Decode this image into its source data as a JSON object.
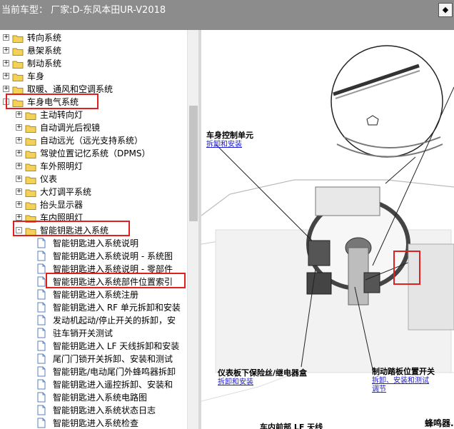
{
  "window": {
    "title": "当前车型： 厂家:D-东风本田UR-V2018",
    "corner_button": "◆"
  },
  "tree": {
    "items": [
      {
        "label": "转向系统",
        "type": "folder",
        "level": 0,
        "expander": "+"
      },
      {
        "label": "悬架系统",
        "type": "folder",
        "level": 0,
        "expander": "+"
      },
      {
        "label": "制动系统",
        "type": "folder",
        "level": 0,
        "expander": "+"
      },
      {
        "label": "车身",
        "type": "folder",
        "level": 0,
        "expander": "+"
      },
      {
        "label": "取暖、通风和空调系统",
        "type": "folder",
        "level": 0,
        "expander": "+"
      },
      {
        "label": "车身电气系统",
        "type": "folder",
        "level": 0,
        "expander": "-",
        "open": true
      },
      {
        "label": "主动转向灯",
        "type": "folder",
        "level": 1,
        "expander": "+"
      },
      {
        "label": "自动调光后视镜",
        "type": "folder",
        "level": 1,
        "expander": "+"
      },
      {
        "label": "自动远光（远光支持系统）",
        "type": "folder",
        "level": 1,
        "expander": "+"
      },
      {
        "label": "驾驶位置记忆系统（DPMS）",
        "type": "folder",
        "level": 1,
        "expander": "+"
      },
      {
        "label": "车外照明灯",
        "type": "folder",
        "level": 1,
        "expander": "+"
      },
      {
        "label": "仪表",
        "type": "folder",
        "level": 1,
        "expander": "+"
      },
      {
        "label": "大灯调平系统",
        "type": "folder",
        "level": 1,
        "expander": "+"
      },
      {
        "label": "抬头显示器",
        "type": "folder",
        "level": 1,
        "expander": "+"
      },
      {
        "label": "车内照明灯",
        "type": "folder",
        "level": 1,
        "expander": "+"
      },
      {
        "label": "智能钥匙进入系统",
        "type": "folder",
        "level": 1,
        "expander": "-",
        "open": true
      },
      {
        "label": "智能钥匙进入系统说明",
        "type": "page",
        "level": 2
      },
      {
        "label": "智能钥匙进入系统说明 - 系统图",
        "type": "page",
        "level": 2
      },
      {
        "label": "智能钥匙进入系统说明 - 零部件",
        "type": "page",
        "level": 2
      },
      {
        "label": "智能钥匙进入系统部件位置索引",
        "type": "page",
        "level": 2
      },
      {
        "label": "智能钥匙进入系统注册",
        "type": "page",
        "level": 2
      },
      {
        "label": "智能钥匙进入 RF 单元拆卸和安装",
        "type": "page",
        "level": 2
      },
      {
        "label": "发动机起动/停止开关的拆卸，安",
        "type": "page",
        "level": 2
      },
      {
        "label": "驻车销开关测试",
        "type": "page",
        "level": 2
      },
      {
        "label": "智能钥匙进入 LF 天线拆卸和安装",
        "type": "page",
        "level": 2
      },
      {
        "label": "尾门门锁开关拆卸、安装和测试",
        "type": "page",
        "level": 2
      },
      {
        "label": "智能钥匙/电动尾门外蜂鸣器拆卸",
        "type": "page",
        "level": 2
      },
      {
        "label": "智能钥匙进入遥控拆卸、安装和",
        "type": "page",
        "level": 2
      },
      {
        "label": "智能钥匙进入系统电路图",
        "type": "page",
        "level": 2
      },
      {
        "label": "智能钥匙进入系统状态日志",
        "type": "page",
        "level": 2
      },
      {
        "label": "智能钥匙进入系统检查",
        "type": "page",
        "level": 2
      }
    ]
  },
  "doc": {
    "callout_body_module": {
      "title": "车身控制单元",
      "link": "拆卸和安装"
    },
    "callout_fuse_box": {
      "title": "仪表板下保险丝/继电器盒",
      "link": "拆卸和安装"
    },
    "callout_brake_switch": {
      "title": "制动踏板位置开关",
      "link1": "拆卸、安装和测试",
      "link2": "调节"
    },
    "callout_front_antenna": {
      "title": "车内前部 LF 天线"
    },
    "callout_right": {
      "title": "蜂鸣器..."
    }
  },
  "colors": {
    "highlight": "#e02020",
    "link": "#1a1ad0",
    "titlebar": "#8c8c8c"
  }
}
